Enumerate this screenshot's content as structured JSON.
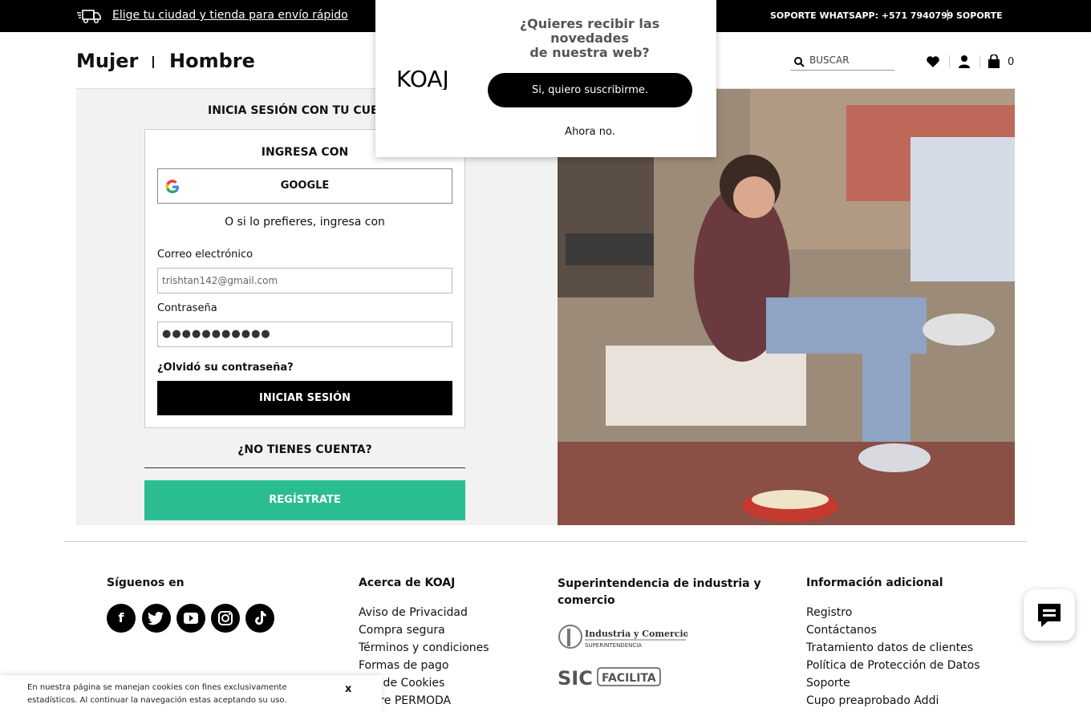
{
  "topbar": {
    "shipping_link": "Elige tu ciudad y tienda para envío rápido",
    "support_whatsapp": "SOPORTE WHATSAPP: +571 7940799",
    "separator": "|",
    "support": "SOPORTE"
  },
  "header": {
    "nav_mujer": "Mujer",
    "nav_separator": "I",
    "nav_hombre": "Hombre",
    "search_placeholder": "BUSCAR",
    "cart_count": "0"
  },
  "login": {
    "title": "INICIA SESIÓN CON TU CUENTA",
    "ingresa_con": "INGRESA CON",
    "google_label": "GOOGLE",
    "alt_text": "O si lo prefieres, ingresa con",
    "email_label": "Correo electrónico",
    "email_value": "trishtan142@gmail.com",
    "password_label": "Contraseña",
    "password_value": "●●●●●●●●●●●",
    "forgot": "¿Olvidó su contraseña?",
    "submit": "INICIAR SESIÓN",
    "no_account": "¿NO TIENES CUENTA?",
    "register": "REGÍSTRATE"
  },
  "popup": {
    "logo": "KOAJ",
    "question_line1": "¿Quieres recibir las novedades",
    "question_line2": "de nuestra web?",
    "accept": "Si, quiero suscribirme.",
    "decline": "Ahora no."
  },
  "footer": {
    "follow_heading": "Síguenos en",
    "social_icons": [
      "facebook-icon",
      "twitter-icon",
      "youtube-icon",
      "instagram-icon",
      "tiktok-icon"
    ],
    "about_heading": "Acerca de KOAJ",
    "about_links": [
      "Aviso de Privacidad",
      "Compra segura",
      "Términos y condiciones",
      "Formas de pago",
      "Uso de Cookies",
      "Sobre PERMODA"
    ],
    "sic_heading": "Superintendencia de industria y comercio",
    "sic_logo1": "Industria y Comercio SUPERINTENDENCIA",
    "sic_logo2": "SIC FACILITA",
    "info_heading": "Información adicional",
    "info_links": [
      "Registro",
      "Contáctanos",
      "Tratamiento datos de clientes",
      "Política de Protección de Datos",
      "Soporte",
      "Cupo preaprobado Addi"
    ]
  },
  "cookie_banner": {
    "text": "En nuestra página se manejan cookies con fines exclusivamente estadísticos. Al continuar la navegación estas aceptando su uso.",
    "close": "x"
  }
}
